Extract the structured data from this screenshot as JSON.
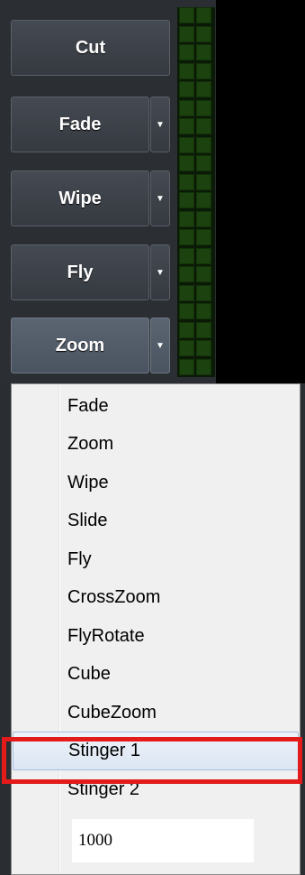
{
  "transitions": {
    "cut_label": "Cut",
    "fade_label": "Fade",
    "wipe_label": "Wipe",
    "fly_label": "Fly",
    "zoom_label": "Zoom",
    "dropdown_icon": "chevron-down-icon"
  },
  "menu": {
    "items": [
      "Fade",
      "Zoom",
      "Wipe",
      "Slide",
      "Fly",
      "CrossZoom",
      "FlyRotate",
      "Cube",
      "CubeZoom",
      "Stinger 1",
      "Stinger 2"
    ],
    "highlighted": "Stinger 1",
    "duration_value": "1000"
  },
  "colors": {
    "highlight_border": "#e31b1b",
    "meter_segment": "#1c4210",
    "button_active": "#5b6572"
  }
}
